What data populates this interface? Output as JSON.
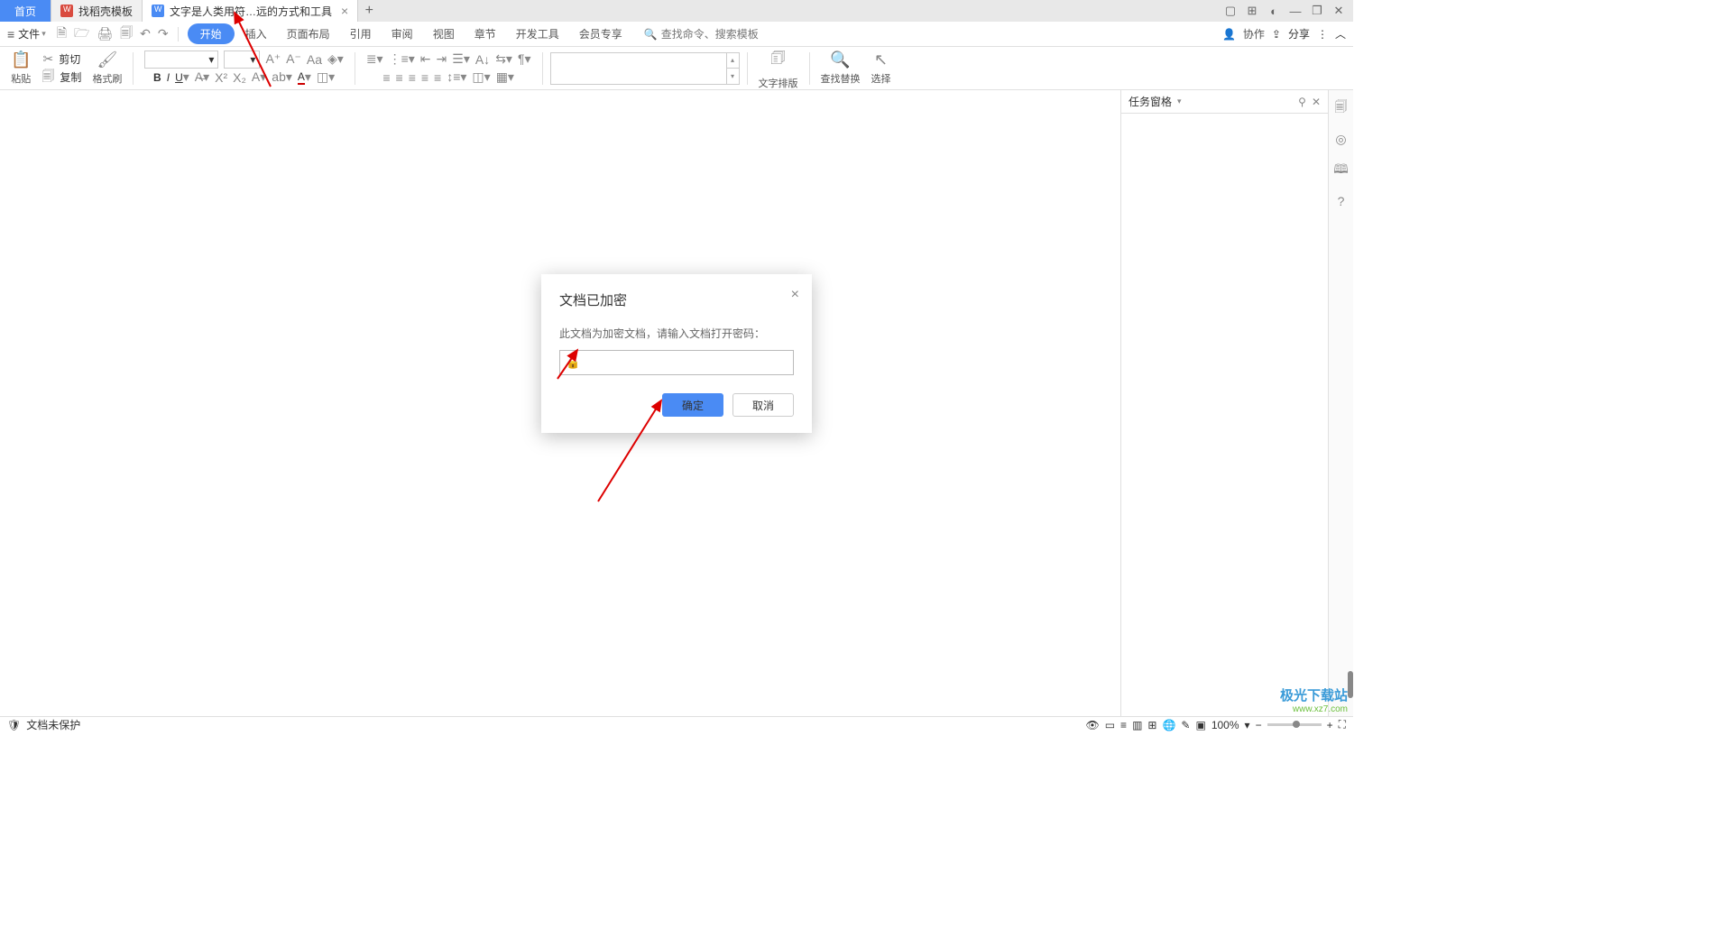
{
  "tabs": {
    "home": "首页",
    "templates": "找稻壳模板",
    "doc": "文字是人类用符…远的方式和工具"
  },
  "filemenu": "文件",
  "menus": [
    "开始",
    "插入",
    "页面布局",
    "引用",
    "审阅",
    "视图",
    "章节",
    "开发工具",
    "会员专享"
  ],
  "search_placeholder": "查找命令、搜索模板",
  "collab": "协作",
  "share": "分享",
  "clipboard": {
    "cut": "剪切",
    "copy": "复制",
    "paste": "粘贴",
    "format_painter": "格式刷"
  },
  "groups": {
    "text_layout": "文字排版",
    "find_replace": "查找替换",
    "select": "选择"
  },
  "taskpane": {
    "title": "任务窗格"
  },
  "dialog": {
    "title": "文档已加密",
    "message": "此文档为加密文档，请输入文档打开密码：",
    "ok": "确定",
    "cancel": "取消"
  },
  "status": {
    "protect": "文档未保护",
    "zoom": "100%"
  },
  "watermark": {
    "l1": "极光下载站",
    "l2": "www.xz7.com"
  }
}
